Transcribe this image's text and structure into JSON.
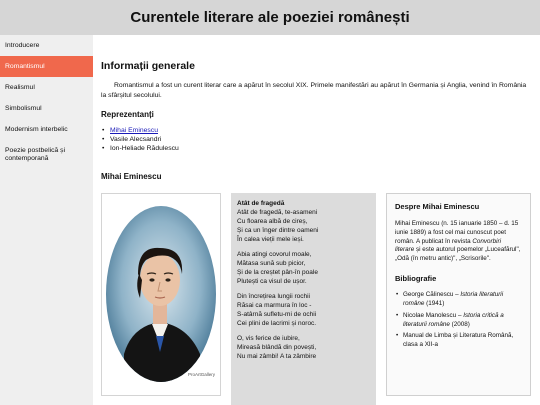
{
  "header": {
    "title": "Curentele literare ale poeziei românești"
  },
  "sidebar": {
    "items": [
      {
        "label": "Introducere"
      },
      {
        "label": "Romantismul"
      },
      {
        "label": "Realismul"
      },
      {
        "label": "Simbolismul"
      },
      {
        "label": "Modernism interbelic"
      },
      {
        "label": "Poezie postbelică și contemporană"
      }
    ],
    "active_index": 1,
    "active_color": "#f0684c"
  },
  "main": {
    "section_title": "Informații generale",
    "intro_text": "Romantismul a fost un curent literar care a apărut în secolul XIX. Primele manifestări au apărut în Germania și Anglia, venind în România la sfârșitul secolului.",
    "representatives_title": "Reprezentanți",
    "representatives": [
      "Mihai Eminescu",
      "Vasile Alecsandri",
      "Ion-Heliade Rădulescu"
    ],
    "featured_title": "Mihai Eminescu",
    "portrait_watermark": "ProArtGallery"
  },
  "poem": {
    "title": "Atât de fragedă",
    "stanzas": [
      [
        "Atât de fragedă, te-asameni",
        "Cu floarea albă de cireș,",
        "Și ca un înger dintre oameni",
        "În calea vieții mele ieși."
      ],
      [
        "Abia atingi covorul moale,",
        "Mătasa sună sub picior,",
        "Și de la creștet pân-în poale",
        "Plutești ca visul de ușor."
      ],
      [
        "Din încrețirea lungii rochii",
        "Răsai ca marmura în loc -",
        "S-atârnă sufletu-mi de ochii",
        "Cei plini de lacrimi și noroc."
      ],
      [
        "O, vis ferice de iubire,",
        "Mireasă blândă din povești,",
        "Nu mai zâmbi! A ta zâmbire"
      ]
    ]
  },
  "about": {
    "title": "Despre Mihai Eminescu",
    "bio_part1": "Mihai Eminescu (n. 15 ianuarie 1850 – d. 15 iunie 1889) a fost cel mai cunoscut poet român. A publicat în revista ",
    "bio_journal": "Convorbiri literare",
    "bio_part2": " și este autorul poemelor „Luceafărul\", „Odă (în metru antic)\", „Scrisorile\".",
    "bibliography_title": "Bibliografie",
    "bibliography": [
      {
        "author": "George Călinescu – ",
        "work": "Istoria literaturii române",
        "year": " (1941)"
      },
      {
        "author": "Nicolae Manolescu – ",
        "work": "Istoria critică a literaturii române",
        "year": " (2008)"
      },
      {
        "author": "Manual de Limba și Literatura Română, clasa a XII-a",
        "work": "",
        "year": ""
      }
    ]
  }
}
